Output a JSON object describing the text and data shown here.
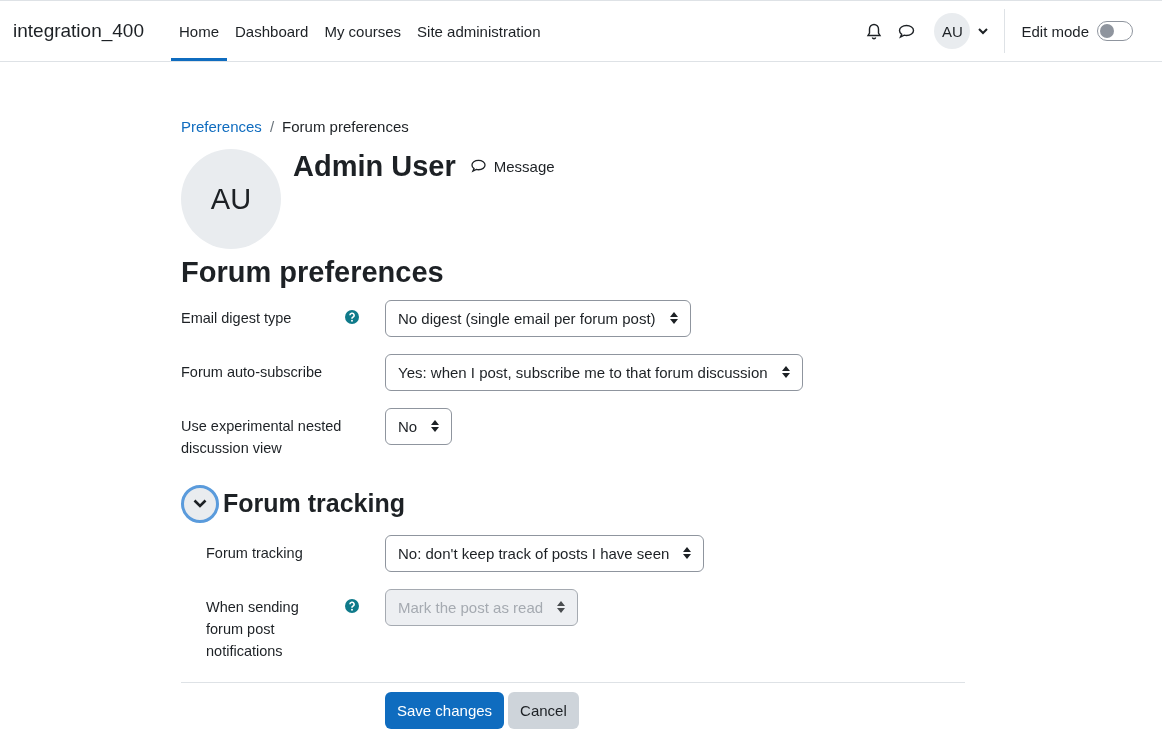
{
  "site_name": "integration_400",
  "nav": [
    {
      "label": "Home",
      "selected": true
    },
    {
      "label": "Dashboard",
      "selected": false
    },
    {
      "label": "My courses",
      "selected": false
    },
    {
      "label": "Site administration",
      "selected": false
    }
  ],
  "user_menu": {
    "initials": "AU"
  },
  "edit_mode": {
    "label": "Edit mode",
    "on": false
  },
  "breadcrumb_separator": "/",
  "breadcrumb": [
    {
      "label": "Preferences",
      "link": true
    },
    {
      "label": "Forum preferences",
      "link": false
    }
  ],
  "profile": {
    "initials": "AU",
    "name": "Admin User",
    "message": "Message"
  },
  "page_title": "Forum preferences",
  "fields": [
    {
      "label": "Email digest type",
      "help": true,
      "value": "No digest (single email per forum post)",
      "disabled": false
    },
    {
      "label": "Forum auto-subscribe",
      "help": false,
      "value": "Yes: when I post, subscribe me to that forum discussion",
      "disabled": false
    },
    {
      "label": "Use experimental nested discussion view",
      "help": false,
      "value": "No",
      "disabled": false
    }
  ],
  "section": {
    "title": "Forum tracking",
    "expanded": true,
    "fields": [
      {
        "label": "Forum tracking",
        "help": false,
        "value": "No: don't keep track of posts I have seen",
        "disabled": false
      },
      {
        "label": "When sending forum post notifications",
        "help": true,
        "value": "Mark the post as read",
        "disabled": true
      }
    ]
  },
  "buttons": [
    {
      "label": "Save changes",
      "kind": "primary"
    },
    {
      "label": "Cancel",
      "kind": "secondary"
    }
  ]
}
